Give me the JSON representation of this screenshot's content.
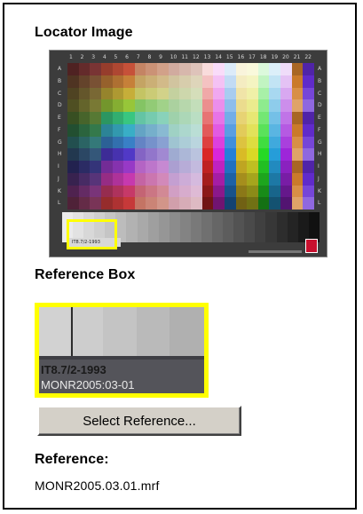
{
  "locator": {
    "title": "Locator Image",
    "column_numbers": [
      "1",
      "2",
      "3",
      "4",
      "5",
      "6",
      "7",
      "8",
      "9",
      "10",
      "11",
      "12",
      "13",
      "14",
      "15",
      "16",
      "17",
      "18",
      "19",
      "20",
      "21",
      "22"
    ],
    "row_letters": [
      "A",
      "B",
      "C",
      "D",
      "E",
      "F",
      "G",
      "H",
      "I",
      "J",
      "K",
      "L"
    ],
    "grayscale_label": "IT8.7/2-1993"
  },
  "reference_box": {
    "title": "Reference Box",
    "label_line1": "IT8.7/2-1993",
    "label_line2": "MONR2005:03-01",
    "highlight_color": "#ffff00"
  },
  "select_button": {
    "label": "Select Reference..."
  },
  "reference": {
    "title": "Reference:",
    "value": "MONR2005.03.01.mrf"
  }
}
